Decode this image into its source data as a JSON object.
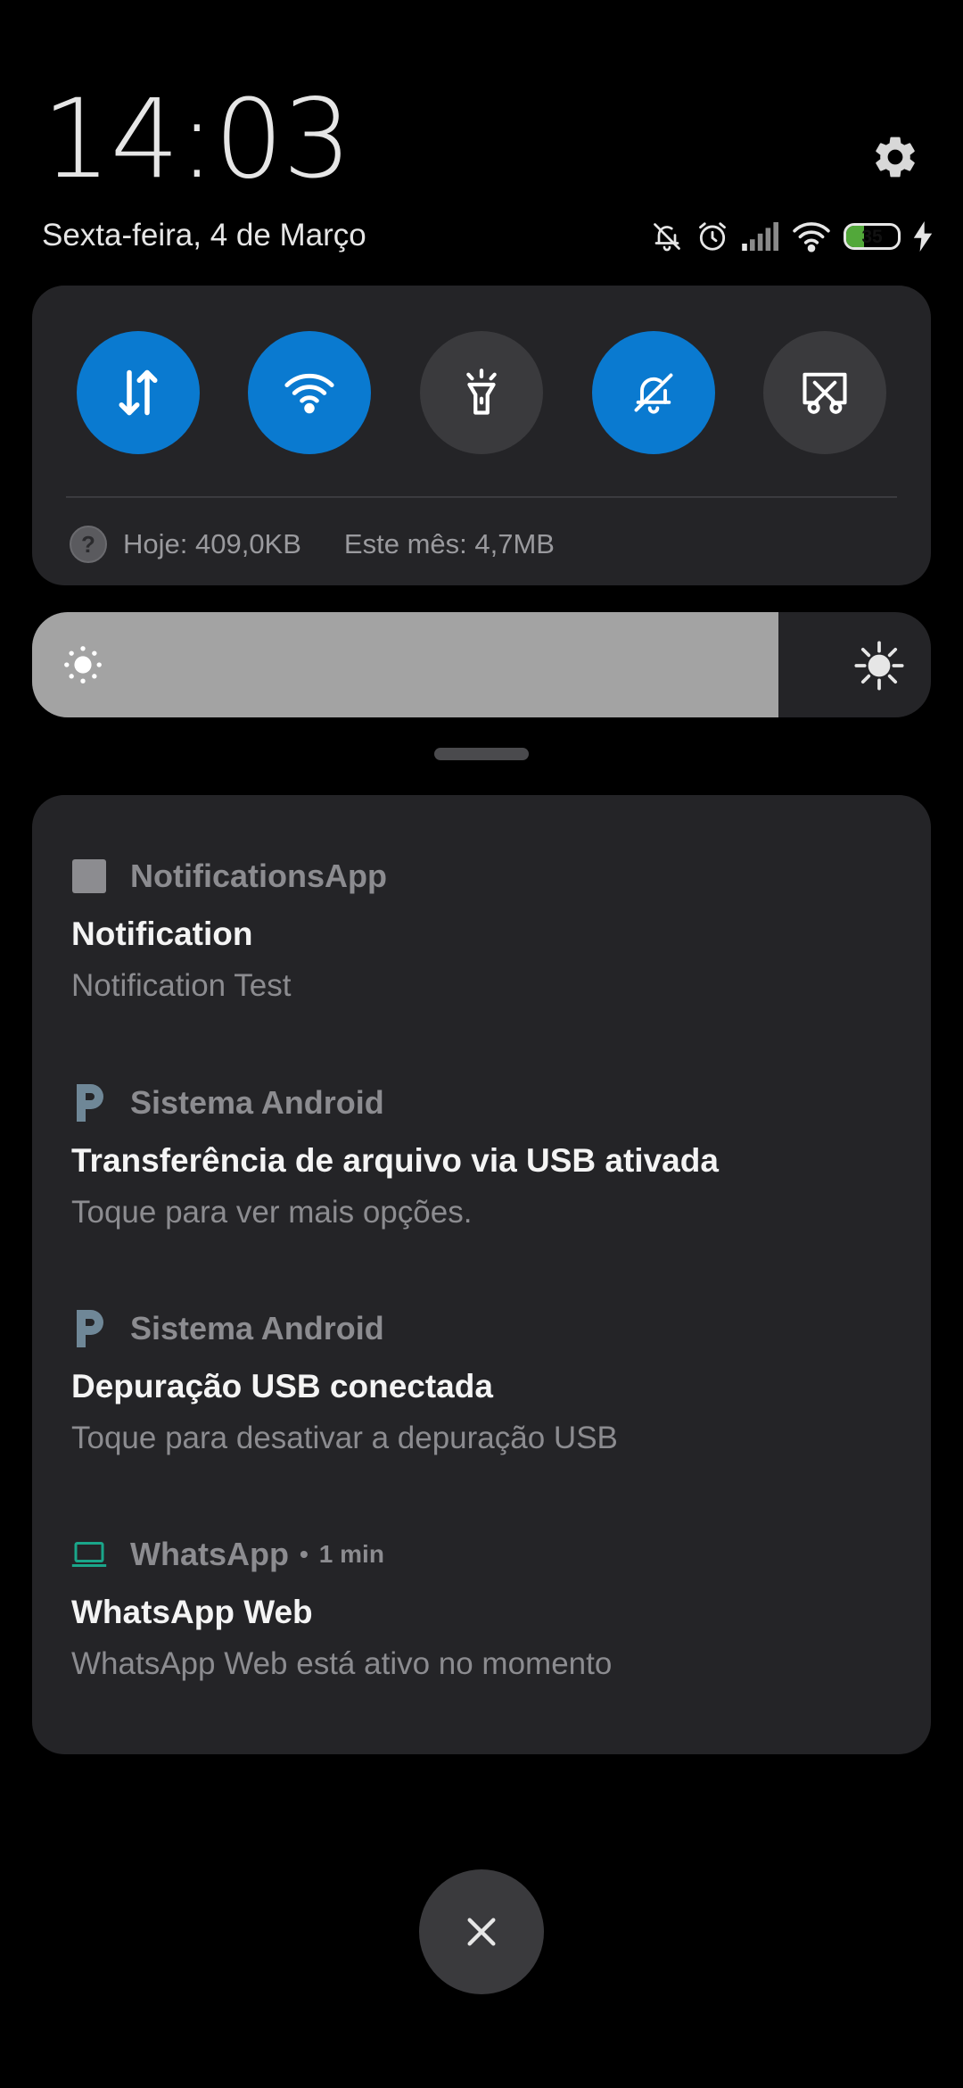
{
  "header": {
    "time": "14:03",
    "date": "Sexta-feira, 4 de Março",
    "settings_icon": "gear-icon"
  },
  "status_bar": {
    "icons": [
      "bell-off-icon",
      "alarm-icon",
      "signal-icon",
      "wifi-icon",
      "battery-icon",
      "charging-icon"
    ],
    "battery_level": "35",
    "battery_fraction": 0.35,
    "battery_color": "#52a83a"
  },
  "quick_settings": {
    "toggles": [
      {
        "icon": "mobile-data-icon",
        "state": "on"
      },
      {
        "icon": "wifi-icon",
        "state": "on"
      },
      {
        "icon": "flashlight-icon",
        "state": "off"
      },
      {
        "icon": "mute-icon",
        "state": "on"
      },
      {
        "icon": "screenshot-icon",
        "state": "off"
      }
    ],
    "active_color": "#0a7ad0",
    "inactive_color": "#3a3a3d",
    "data_usage": {
      "help_glyph": "?",
      "today": "Hoje: 409,0KB",
      "month": "Este mês: 4,7MB"
    }
  },
  "brightness": {
    "level": 0.83,
    "low_icon": "brightness-low-icon",
    "high_icon": "brightness-high-icon"
  },
  "notifications": [
    {
      "app": "NotificationsApp",
      "icon": "app-square-icon",
      "title": "Notification",
      "text": "Notification Test"
    },
    {
      "app": "Sistema Android",
      "icon": "android-system-icon",
      "title": "Transferência de arquivo via USB ativada",
      "text": "Toque para ver mais opções."
    },
    {
      "app": "Sistema Android",
      "icon": "android-system-icon",
      "title": "Depuração USB conectada",
      "text": "Toque para desativar a depuração USB"
    },
    {
      "app": "WhatsApp",
      "icon": "laptop-icon",
      "separator": "•",
      "time": "1 min",
      "title": "WhatsApp Web",
      "text": "WhatsApp Web está ativo no momento"
    }
  ],
  "close_button": {
    "icon": "close-icon"
  }
}
